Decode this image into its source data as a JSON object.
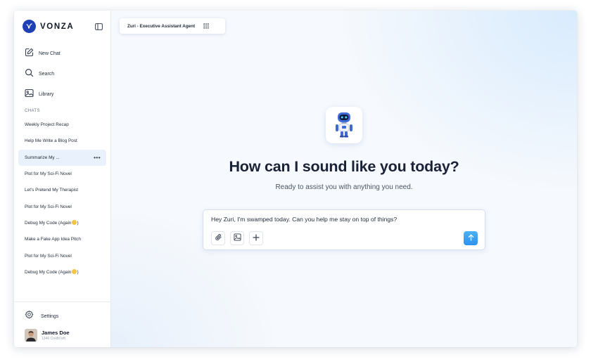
{
  "brand": {
    "name": "VONZA"
  },
  "nav": [
    {
      "label": "New Chat",
      "icon": "new-chat-icon"
    },
    {
      "label": "Search",
      "icon": "search-icon"
    },
    {
      "label": "Library",
      "icon": "library-icon"
    }
  ],
  "chats": {
    "heading": "CHATS",
    "items": [
      {
        "label": "Weekly Project Recap"
      },
      {
        "label": "Help Me Write a Blog Post"
      },
      {
        "label": "Summarize My ...",
        "more": "•••"
      },
      {
        "label": "Plot for My Sci-Fi Novel"
      },
      {
        "label": "Let's Pretend My Therapist"
      },
      {
        "label": "Plot for My Sci-Fi Novel"
      },
      {
        "label": "Debug My Code (Again"
      },
      {
        "label": "Make a Fake App Idea Pitch"
      },
      {
        "label": "Plot for My Sci-Fi Novel"
      },
      {
        "label": "Debug My Code (Again"
      }
    ]
  },
  "settings": {
    "label": "Settings"
  },
  "user": {
    "name": "James Doe",
    "credit": "1346 Credit left"
  },
  "agent": {
    "label": "Zuri - Executive Assistant Agent"
  },
  "hero": {
    "headline": "How can I sound like you today?",
    "subline": "Ready to assist you with anything you need."
  },
  "composer": {
    "value": "Hey Zuri, I'm swamped today. Can you help me stay on top of things?"
  },
  "colors": {
    "accent": "#2d92ef",
    "brand": "#1f3fb4",
    "active_chat_bg": "#e8f1fc"
  }
}
